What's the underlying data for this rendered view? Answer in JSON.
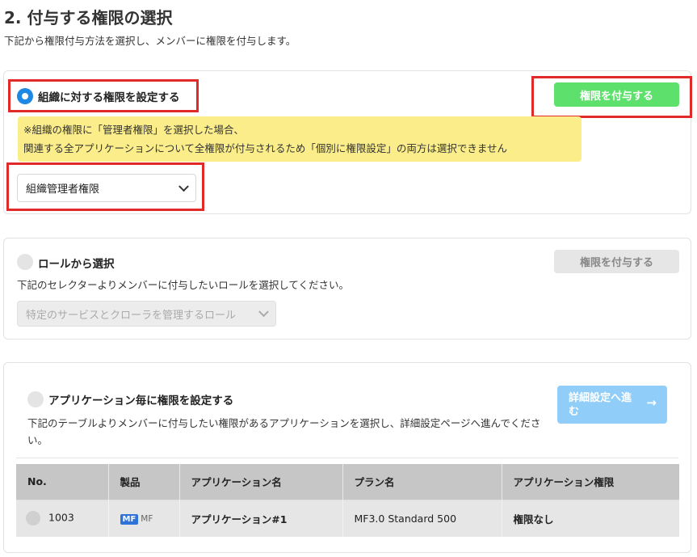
{
  "page": {
    "title": "2. 付与する権限の選択",
    "subtitle": "下記から権限付与方法を選択し、メンバーに権限を付与します。"
  },
  "org_section": {
    "label": "組織に対する権限を設定する",
    "selected": true,
    "grant_button": "権限を付与する",
    "warning_line1": "※組織の権限に「管理者権限」を選択した場合、",
    "warning_line2": "関連する全アプリケーションについて全権限が付与されるため「個別に権限設定」の両方は選択できません",
    "select_value": "組織管理者権限"
  },
  "role_section": {
    "label": "ロールから選択",
    "selected": false,
    "grant_button": "権限を付与する",
    "description": "下記のセレクターよりメンバーに付与したいロールを選択してください。",
    "select_placeholder": "特定のサービスとクローラを管理するロール"
  },
  "app_section": {
    "label": "アプリケーション毎に権限を設定する",
    "selected": false,
    "description": "下記のテーブルよりメンバーに付与したい権限があるアプリケーションを選択し、詳細設定ページへ進んでください。",
    "detail_button": "詳細設定へ進む",
    "table": {
      "headers": [
        "No.",
        "製品",
        "アプリケーション名",
        "プラン名",
        "アプリケーション権限"
      ],
      "rows": [
        {
          "no": "1003",
          "product_badge": "MF",
          "product_text": "MF",
          "app_name": "アプリケーション#1",
          "plan": "MF3.0 Standard 500",
          "permission": "権限なし"
        }
      ]
    }
  },
  "colors": {
    "accent_blue": "#1e88e5",
    "grant_green": "#5ee06d",
    "highlight_red": "#e12b2b",
    "warning_yellow": "#fbee8a"
  }
}
